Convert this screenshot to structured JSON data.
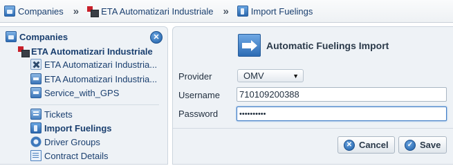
{
  "breadcrumb": {
    "items": [
      {
        "label": "Companies",
        "icon": "companies-icon"
      },
      {
        "label": "ETA Automatizari Industriale",
        "icon": "company-flag-icon"
      },
      {
        "label": "Import Fuelings",
        "icon": "fuel-pump-icon"
      }
    ],
    "separator": "»"
  },
  "sidebar": {
    "root_label": "Companies",
    "close_glyph": "✕",
    "company_label": "ETA Automatizari Industriale",
    "items": [
      {
        "label": "ETA Automatizari Industria...",
        "icon": "tools-icon"
      },
      {
        "label": "ETA Automatizari Industria...",
        "icon": "phone-device-icon"
      },
      {
        "label": "Service_with_GPS",
        "icon": "phone-device-icon"
      },
      {
        "label": "Tickets",
        "icon": "tickets-icon"
      },
      {
        "label": "Import Fuelings",
        "icon": "fuel-pump-icon",
        "active": true
      },
      {
        "label": "Driver Groups",
        "icon": "driver-groups-icon"
      },
      {
        "label": "Contract Details",
        "icon": "document-icon"
      }
    ]
  },
  "form": {
    "title": "Automatic Fuelings Import",
    "provider_label": "Provider",
    "provider_value": "OMV",
    "username_label": "Username",
    "username_value": "710109200388",
    "password_label": "Password",
    "password_value": "••••••••••",
    "cancel_label": "Cancel",
    "save_label": "Save"
  },
  "colors": {
    "link": "#1a3f6f",
    "panel_bg": "#eef2f6",
    "accent": "#2d6cb4"
  }
}
